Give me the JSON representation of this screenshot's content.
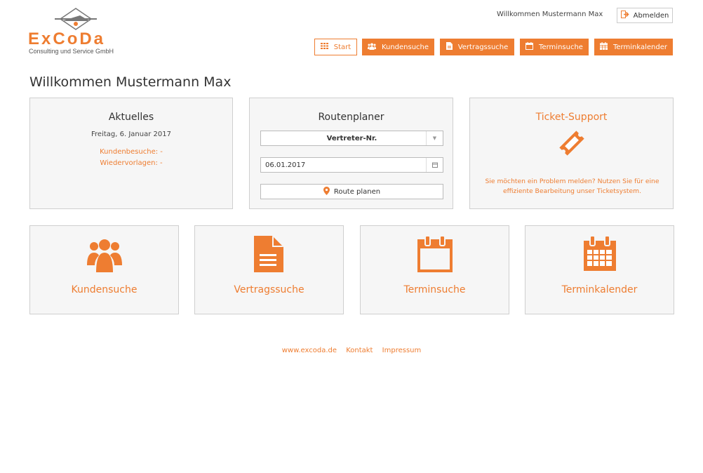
{
  "colors": {
    "accent": "#ee7d31",
    "panel_bg": "#f6f6f6",
    "border": "#cfcfcf"
  },
  "logo": {
    "word": "ExCoDa",
    "sub": "Consulting und Service GmbH",
    "icon": "logo-mark-icon"
  },
  "header": {
    "welcome": "Willkommen Mustermann Max",
    "logout_label": "Abmelden",
    "logout_icon": "sign-out-icon"
  },
  "nav": [
    {
      "label": "Start",
      "icon": "grid-icon"
    },
    {
      "label": "Kundensuche",
      "icon": "users-icon"
    },
    {
      "label": "Vertragssuche",
      "icon": "document-icon"
    },
    {
      "label": "Terminsuche",
      "icon": "calendar-icon"
    },
    {
      "label": "Terminkalender",
      "icon": "calendar-grid-icon"
    }
  ],
  "page_title": "Willkommen Mustermann Max",
  "panels": {
    "aktuelles": {
      "title": "Aktuelles",
      "date": "Freitag, 6. Januar 2017",
      "kundenbesuche": "Kundenbesuche: -",
      "wiedervorlagen": "Wiedervorlagen: -"
    },
    "routenplaner": {
      "title": "Routenplaner",
      "select_value": "Vertreter-Nr.",
      "date_value": "06.01.2017",
      "button_label": "Route planen"
    },
    "ticket": {
      "title": "Ticket-Support",
      "icon": "ticket-icon",
      "description": "Sie möchten ein Problem melden? Nutzen Sie für eine effiziente Bearbeitung unser Ticketsystem."
    }
  },
  "tiles": [
    {
      "label": "Kundensuche",
      "icon": "users-icon"
    },
    {
      "label": "Vertragssuche",
      "icon": "document-icon"
    },
    {
      "label": "Terminsuche",
      "icon": "calendar-icon"
    },
    {
      "label": "Terminkalender",
      "icon": "calendar-grid-icon"
    }
  ],
  "footer": [
    {
      "label": "www.excoda.de"
    },
    {
      "label": "Kontakt"
    },
    {
      "label": "Impressum"
    }
  ]
}
